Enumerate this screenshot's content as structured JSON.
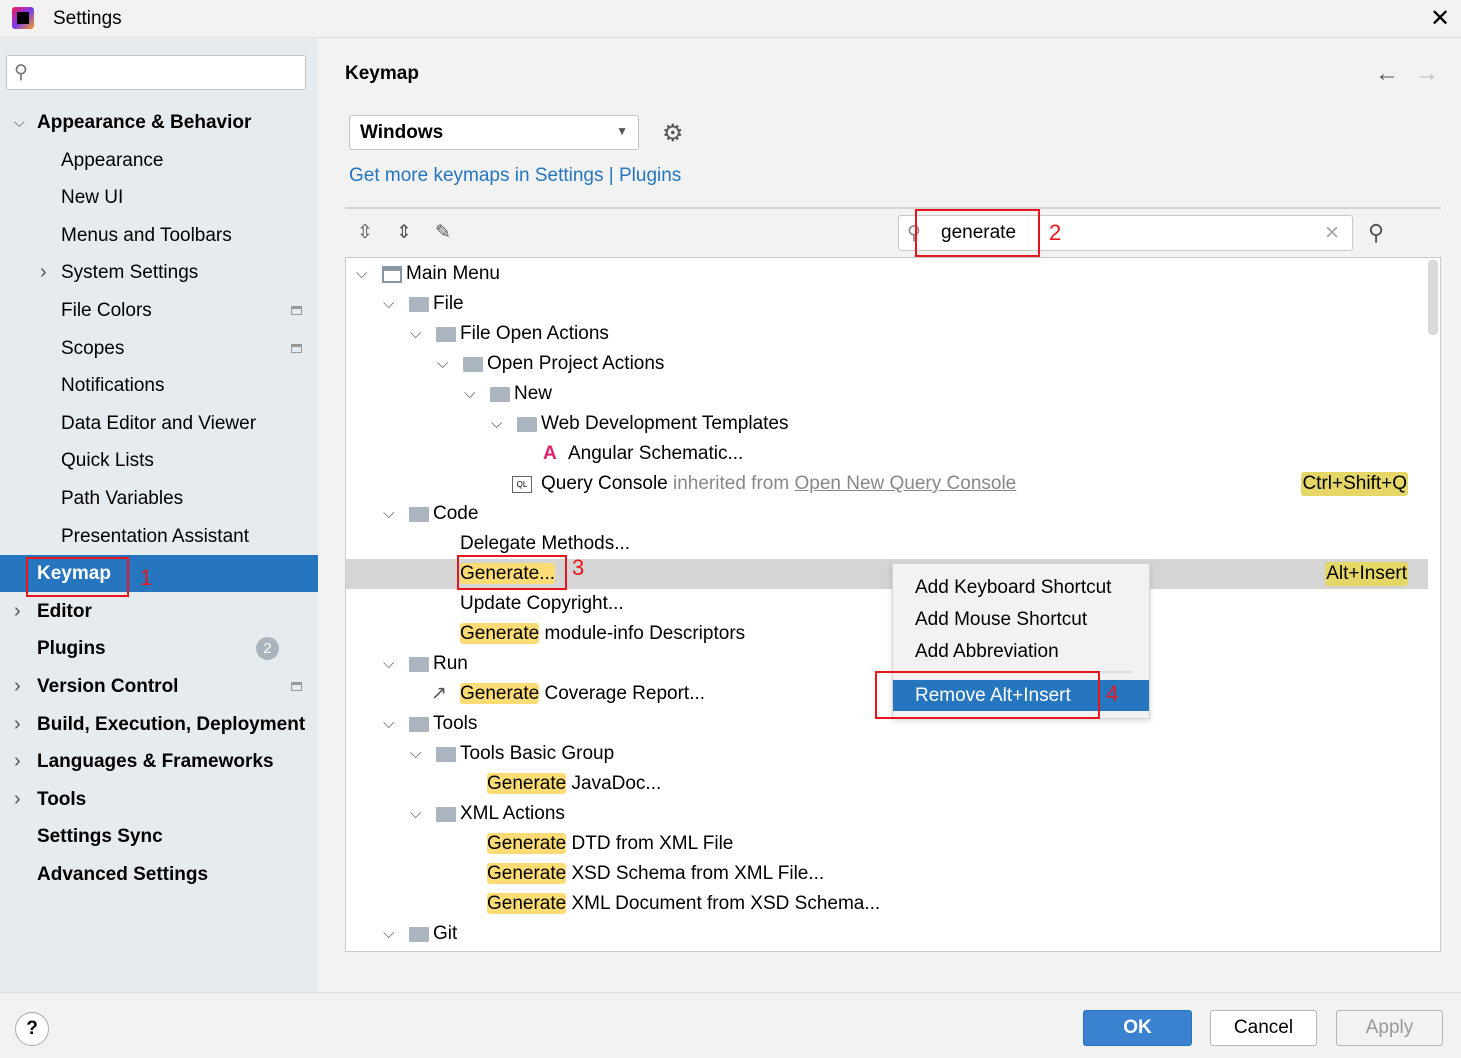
{
  "window": {
    "title": "Settings"
  },
  "sidebar": {
    "search_placeholder": "",
    "items": [
      {
        "label": "Appearance & Behavior",
        "level": 0,
        "bold": true,
        "chevron": "down"
      },
      {
        "label": "Appearance",
        "level": 1
      },
      {
        "label": "New UI",
        "level": 1
      },
      {
        "label": "Menus and Toolbars",
        "level": 1
      },
      {
        "label": "System Settings",
        "level": 1,
        "chevron": "right"
      },
      {
        "label": "File Colors",
        "level": 1,
        "badge": "project-icon"
      },
      {
        "label": "Scopes",
        "level": 1,
        "badge": "project-icon"
      },
      {
        "label": "Notifications",
        "level": 1
      },
      {
        "label": "Data Editor and Viewer",
        "level": 1
      },
      {
        "label": "Quick Lists",
        "level": 1
      },
      {
        "label": "Path Variables",
        "level": 1
      },
      {
        "label": "Presentation Assistant",
        "level": 1
      },
      {
        "label": "Keymap",
        "level": 0,
        "bold": true,
        "selected": true
      },
      {
        "label": "Editor",
        "level": 0,
        "bold": true,
        "chevron": "right"
      },
      {
        "label": "Plugins",
        "level": 0,
        "bold": true,
        "count": "2"
      },
      {
        "label": "Version Control",
        "level": 0,
        "bold": true,
        "chevron": "right",
        "badge": "project-icon"
      },
      {
        "label": "Build, Execution, Deployment",
        "level": 0,
        "bold": true,
        "chevron": "right"
      },
      {
        "label": "Languages & Frameworks",
        "level": 0,
        "bold": true,
        "chevron": "right"
      },
      {
        "label": "Tools",
        "level": 0,
        "bold": true,
        "chevron": "right"
      },
      {
        "label": "Settings Sync",
        "level": 0,
        "bold": true
      },
      {
        "label": "Advanced Settings",
        "level": 0,
        "bold": true
      }
    ]
  },
  "main": {
    "title": "Keymap",
    "keymap_select": "Windows",
    "link_text": "Get more keymaps in Settings | Plugins",
    "search_value": "generate"
  },
  "tree": [
    {
      "level": 0,
      "chevron": true,
      "icon": "menu",
      "label": "Main Menu"
    },
    {
      "level": 1,
      "chevron": true,
      "icon": "folder",
      "label": "File"
    },
    {
      "level": 2,
      "chevron": true,
      "icon": "folder",
      "label": "File Open Actions"
    },
    {
      "level": 3,
      "chevron": true,
      "icon": "folder",
      "label": "Open Project Actions"
    },
    {
      "level": 4,
      "chevron": true,
      "icon": "folder",
      "label": "New"
    },
    {
      "level": 5,
      "chevron": true,
      "icon": "folder",
      "label": "Web Development Templates"
    },
    {
      "level": 6,
      "icon": "angular",
      "label": "Angular Schematic..."
    },
    {
      "level": 5,
      "icon": "ql",
      "label": "Query Console",
      "inherited": " inherited from ",
      "inherited_link": "Open New Query Console",
      "shortcut": "Ctrl+Shift+Q"
    },
    {
      "level": 1,
      "chevron": true,
      "icon": "folder",
      "label": "Code"
    },
    {
      "level": 2,
      "label": "Delegate Methods..."
    },
    {
      "level": 2,
      "hl": "Generate...",
      "label": "",
      "selected": true,
      "shortcut": "Alt+Insert"
    },
    {
      "level": 2,
      "label": "Update Copyright..."
    },
    {
      "level": 2,
      "hl": "Generate",
      "label": " module-info Descriptors"
    },
    {
      "level": 1,
      "chevron": true,
      "icon": "folder",
      "label": "Run"
    },
    {
      "level": 2,
      "icon": "export",
      "hl": "Generate",
      "label": " Coverage Report..."
    },
    {
      "level": 1,
      "chevron": true,
      "icon": "folder",
      "label": "Tools"
    },
    {
      "level": 2,
      "chevron": true,
      "icon": "folder",
      "label": "Tools Basic Group"
    },
    {
      "level": 3,
      "hl": "Generate",
      "label": " JavaDoc..."
    },
    {
      "level": 2,
      "chevron": true,
      "icon": "folder",
      "label": "XML Actions"
    },
    {
      "level": 3,
      "hl": "Generate",
      "label": " DTD from XML File"
    },
    {
      "level": 3,
      "hl": "Generate",
      "label": " XSD Schema from XML File..."
    },
    {
      "level": 3,
      "hl": "Generate",
      "label": " XML Document from XSD Schema..."
    },
    {
      "level": 1,
      "chevron": true,
      "icon": "folder",
      "label": "Git"
    }
  ],
  "context_menu": {
    "items": [
      "Add Keyboard Shortcut",
      "Add Mouse Shortcut",
      "Add Abbreviation"
    ],
    "selected": "Remove Alt+Insert"
  },
  "annotations": [
    "1",
    "2",
    "3",
    "4"
  ],
  "footer": {
    "ok": "OK",
    "cancel": "Cancel",
    "apply": "Apply",
    "help": "?"
  },
  "colors": {
    "accent": "#2675bf",
    "highlight": "#fddc75",
    "annotation": "#e8161c"
  }
}
